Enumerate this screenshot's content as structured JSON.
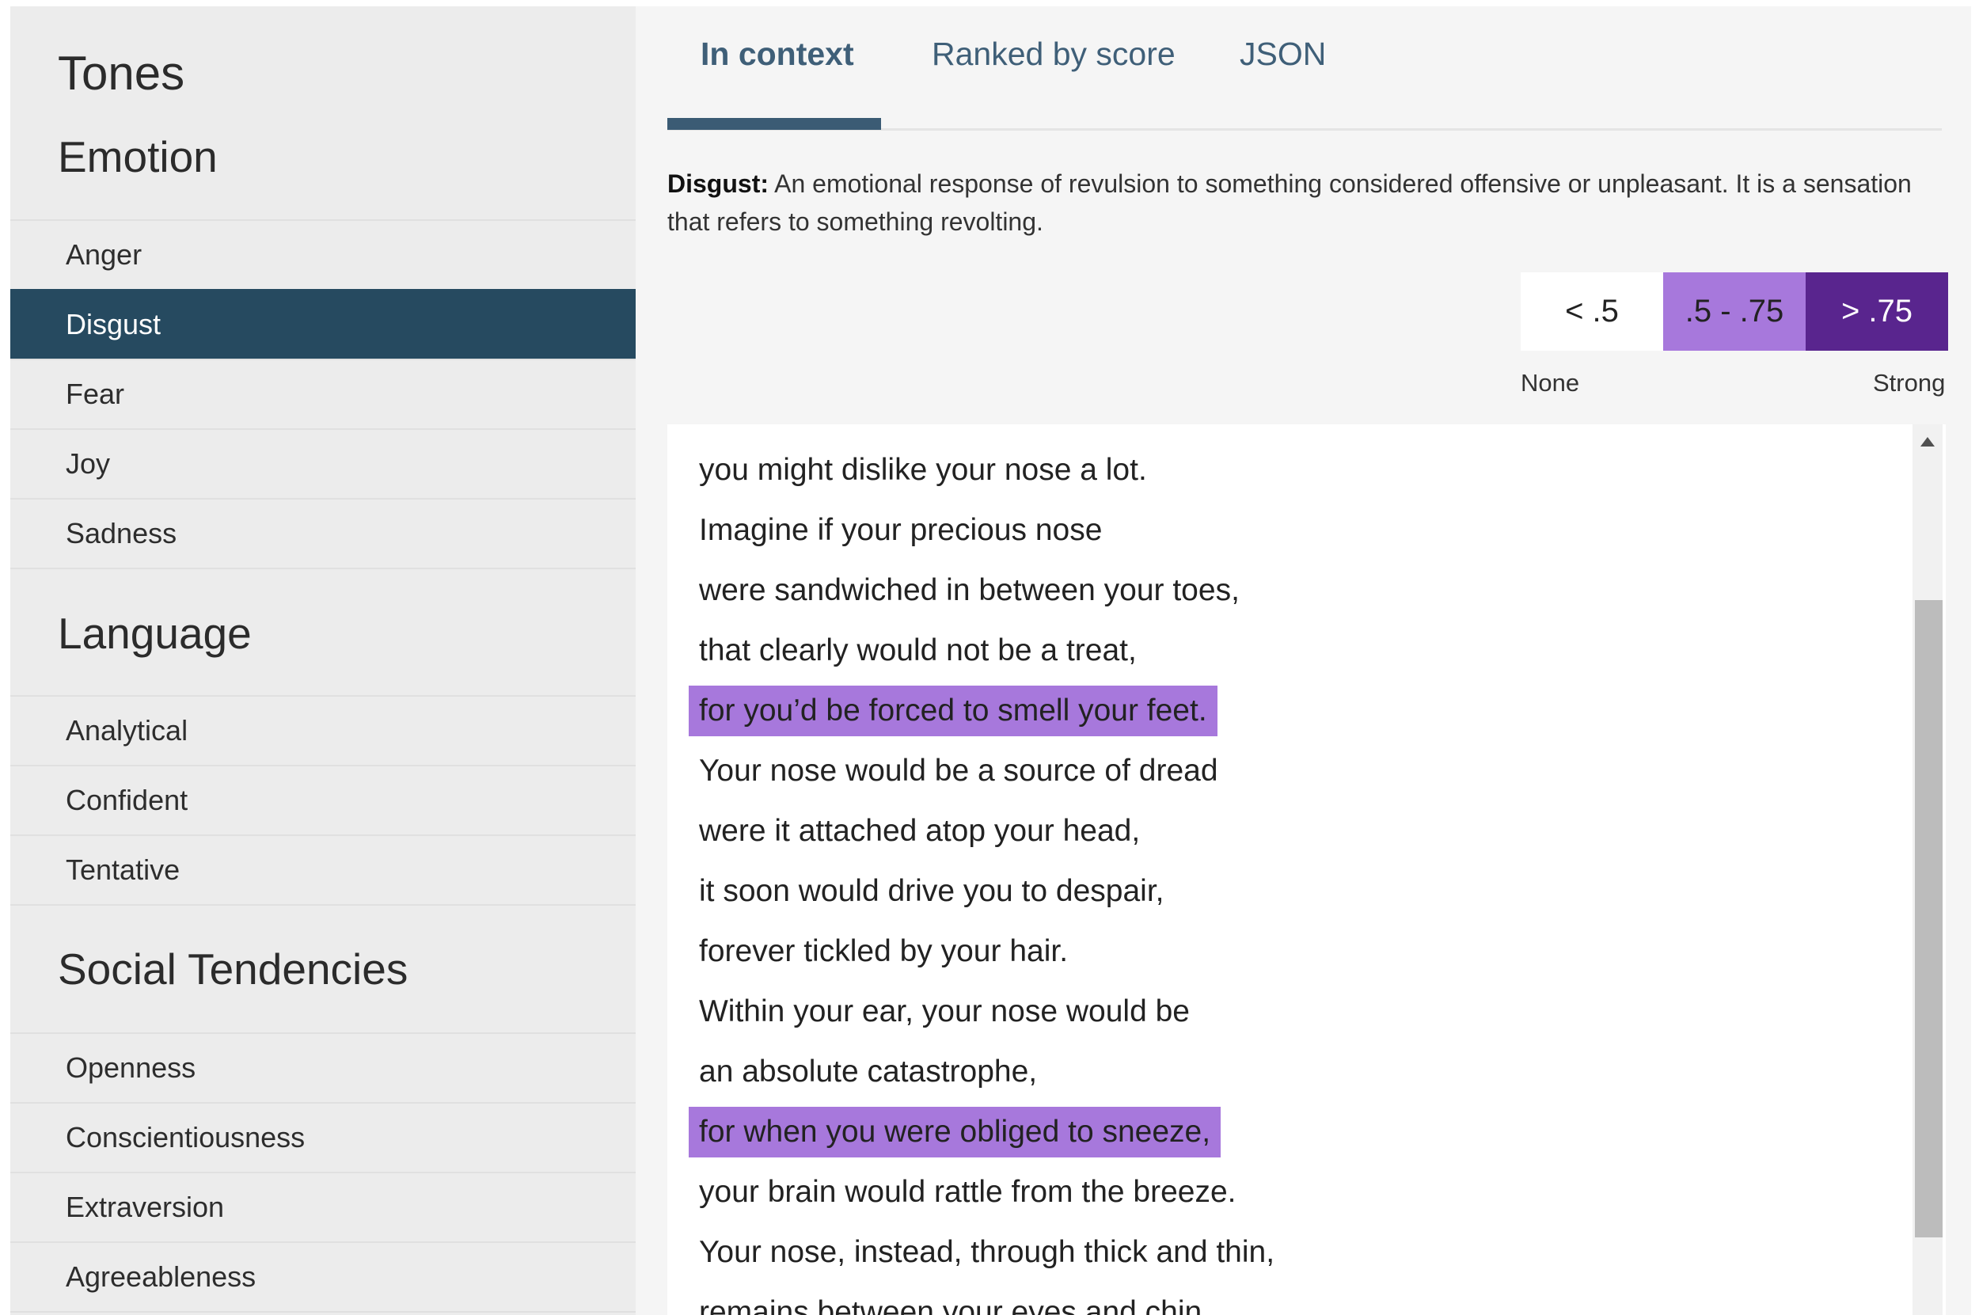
{
  "sidebar": {
    "title": "Tones",
    "sections": {
      "emotion": {
        "heading": "Emotion",
        "items": [
          "Anger",
          "Disgust",
          "Fear",
          "Joy",
          "Sadness"
        ],
        "active": "Disgust"
      },
      "language": {
        "heading": "Language",
        "items": [
          "Analytical",
          "Confident",
          "Tentative"
        ]
      },
      "social": {
        "heading": "Social Tendencies",
        "items": [
          "Openness",
          "Conscientiousness",
          "Extraversion",
          "Agreeableness"
        ]
      }
    }
  },
  "tabs": {
    "in_context": "In context",
    "ranked": "Ranked by score",
    "json": "JSON",
    "active": "In context"
  },
  "definition": {
    "term": "Disgust:",
    "text": " An emotional response of revulsion to something considered offensive or unpleasant. It is a sensation that refers to something revolting."
  },
  "legend": {
    "low": {
      "label": "< .5",
      "color": "#ffffff",
      "text_color": "#222222"
    },
    "mid": {
      "label": ".5 - .75",
      "color": "#a778dc",
      "text_color": "#222222"
    },
    "high": {
      "label": "> .75",
      "color": "#59258e",
      "text_color": "#ffffff"
    },
    "none_label": "None",
    "strong_label": "Strong"
  },
  "poem": {
    "lines": [
      {
        "text": "you might dislike your nose a lot.",
        "highlight": false
      },
      {
        "text": "Imagine if your precious nose",
        "highlight": false
      },
      {
        "text": "were sandwiched in between your toes,",
        "highlight": false
      },
      {
        "text": "that clearly would not be a treat,",
        "highlight": false
      },
      {
        "text": "for you’d be forced to smell your feet.",
        "highlight": true
      },
      {
        "text": "Your nose would be a source of dread",
        "highlight": false
      },
      {
        "text": "were it attached atop your head,",
        "highlight": false
      },
      {
        "text": "it soon would drive you to despair,",
        "highlight": false
      },
      {
        "text": "forever tickled by your hair.",
        "highlight": false
      },
      {
        "text": "Within your ear, your nose would be",
        "highlight": false
      },
      {
        "text": "an absolute catastrophe,",
        "highlight": false
      },
      {
        "text": "for when you were obliged to sneeze,",
        "highlight": true
      },
      {
        "text": "your brain would rattle from the breeze.",
        "highlight": false
      },
      {
        "text": "Your nose, instead, through thick and thin,",
        "highlight": false
      },
      {
        "text": "remains between your eyes and chin,",
        "highlight": false
      }
    ],
    "highlight_color": "#a778dc"
  },
  "colors": {
    "sidebar_active": "#264a60",
    "tab_text": "#3f5f78",
    "tab_underline": "#3b5b74"
  }
}
